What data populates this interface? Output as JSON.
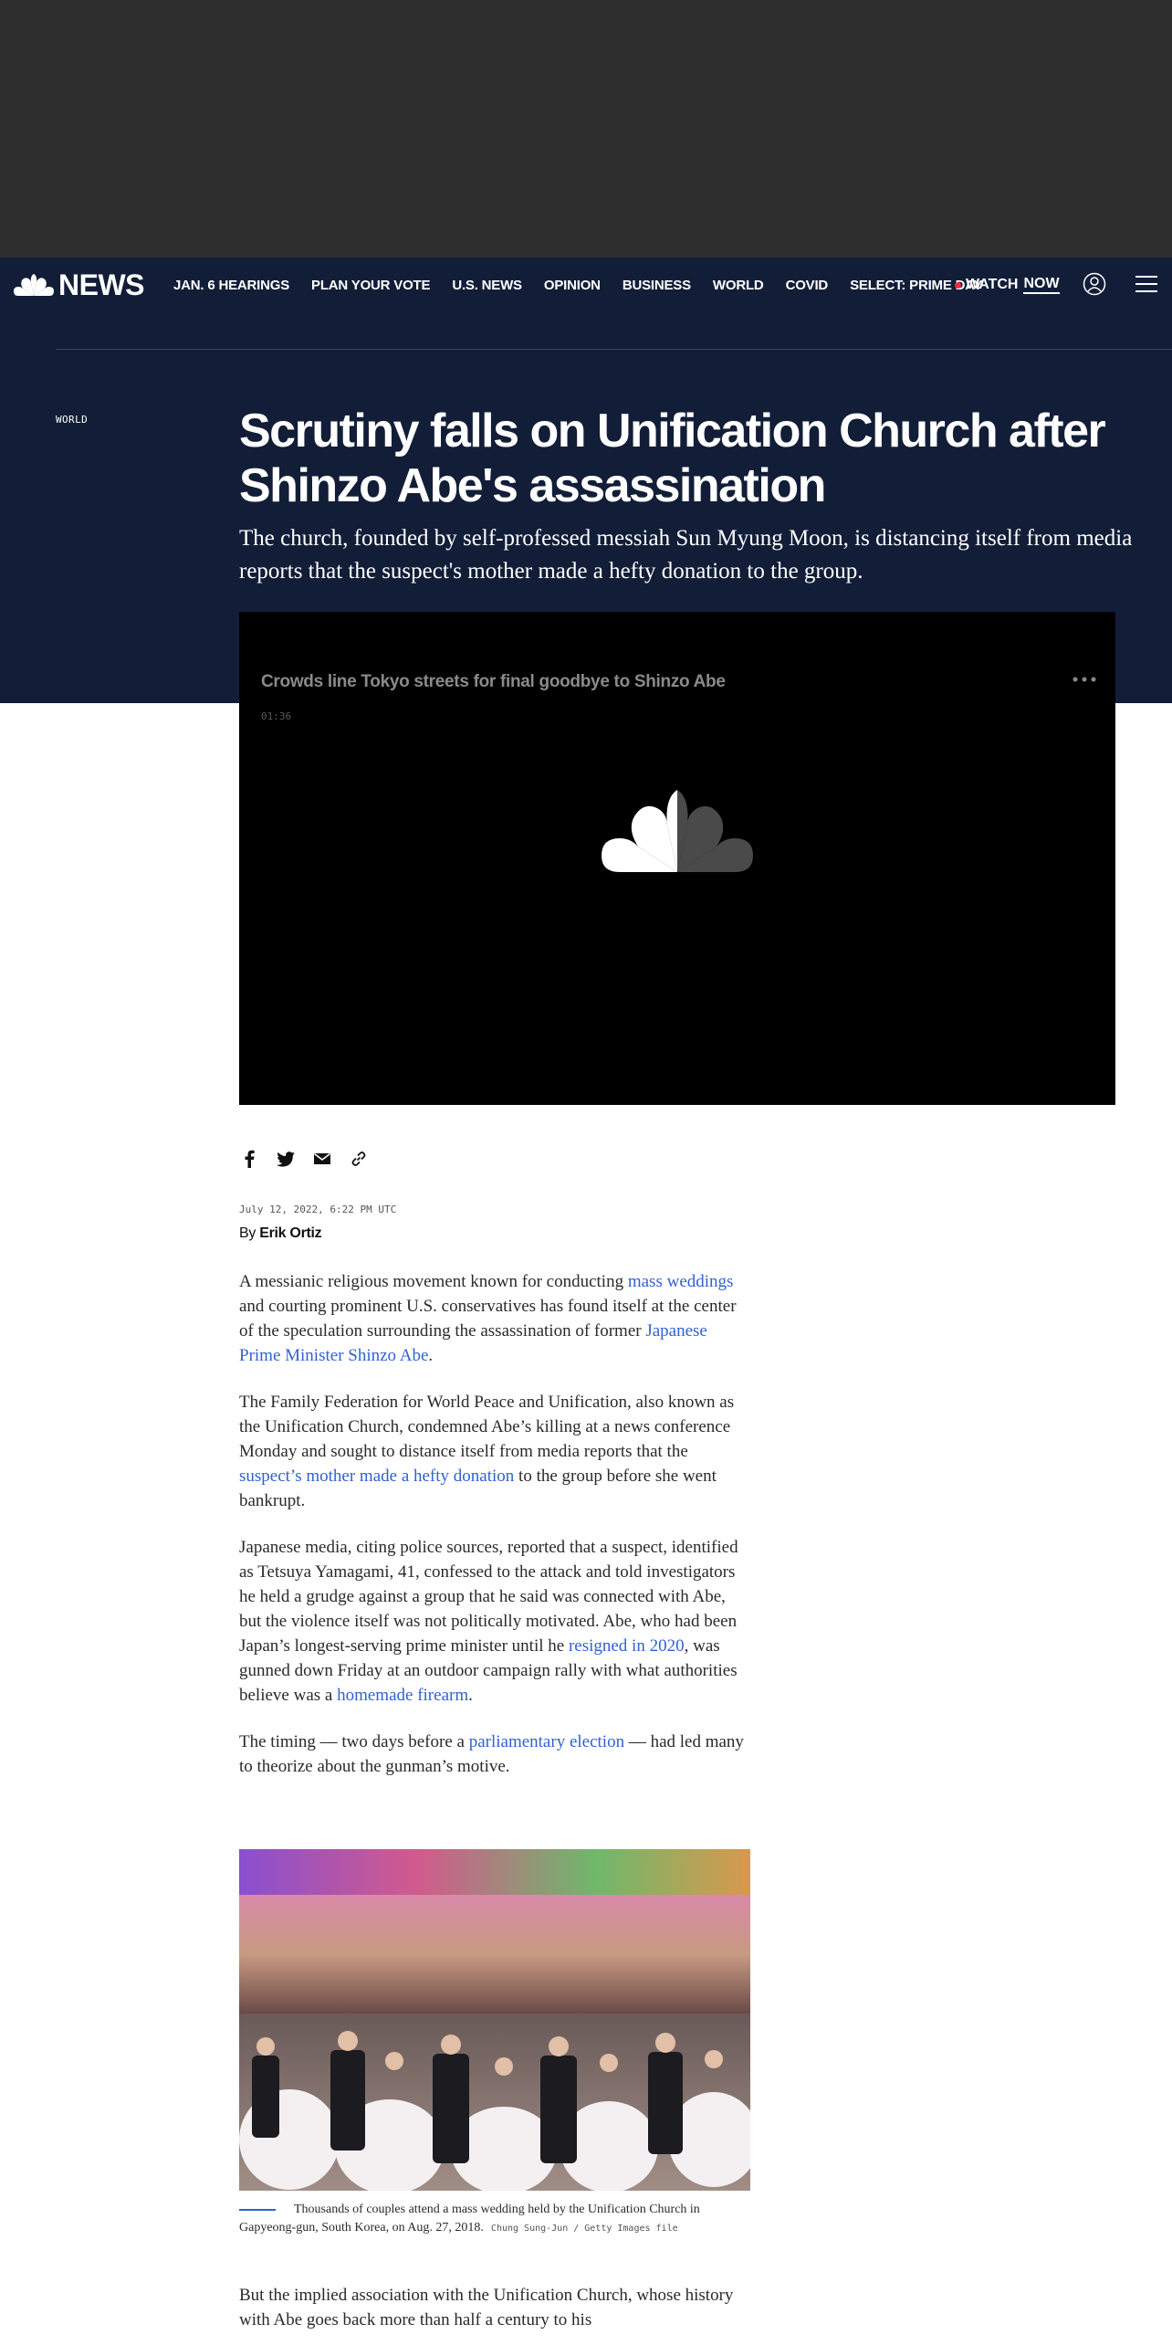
{
  "nav": {
    "logo_text": "NEWS",
    "links": [
      "JAN. 6 HEARINGS",
      "PLAN YOUR VOTE",
      "U.S. NEWS",
      "OPINION",
      "BUSINESS",
      "WORLD",
      "COVID",
      "SELECT: PRIME DAY"
    ],
    "watch_label": "WATCH",
    "watch_now": "NOW"
  },
  "article": {
    "section": "WORLD",
    "headline": "Scrutiny falls on Unification Church after Shinzo Abe's assassination",
    "dek": "The church, founded by self-professed messiah Sun Myung Moon, is distancing itself from media reports that the suspect's mother made a hefty donation to the group.",
    "date": "July 12, 2022, 6:22 PM UTC",
    "byline_prefix": "By",
    "author": "Erik Ortiz"
  },
  "video": {
    "title": "Crowds line Tokyo streets for final goodbye to Shinzo Abe",
    "duration": "01:36"
  },
  "paragraphs": {
    "p1": {
      "t1": "A messianic religious movement known for conducting ",
      "l1": "mass weddings",
      "t2": " and courting prominent U.S. conservatives has found itself at the center of the speculation surrounding the assassination of former ",
      "l2": "Japanese Prime Minister Shinzo Abe",
      "t3": "."
    },
    "p2": {
      "t1": "The Family Federation for World Peace and Unification, also known as the Unification Church, condemned Abe’s killing at a news conference Monday and sought to distance itself from media reports that the ",
      "l1": "suspect’s mother made a hefty donation",
      "t2": " to the group before she went bankrupt."
    },
    "p3": {
      "t1": "Japanese media, citing police sources, reported that a suspect, identified as Tetsuya Yamagami, 41, confessed to the attack and told investigators he held a grudge against a group that he said was connected with Abe, but the violence itself was not politically motivated. Abe, who had been Japan’s longest-serving prime minister until he ",
      "l1": "resigned in 2020",
      "t2": ", was gunned down Friday at an outdoor campaign rally with what authorities believe was a ",
      "l2": "homemade firearm",
      "t3": "."
    },
    "p4": {
      "t1": "The timing — two days before a ",
      "l1": "parliamentary election",
      "t2": " — had led many to theorize about the gunman’s motive."
    },
    "p5": "But the implied association with the Unification Church, whose history with Abe goes back more than half a century to his"
  },
  "photo": {
    "caption": "Thousands of couples attend a mass wedding held by the Unification Church in Gapyeong-gun, South Korea, on Aug. 27, 2018.",
    "credit": "Chung Sung-Jun / Getty Images file"
  },
  "colors": {
    "hero_bg": "#121e38",
    "ad_bg": "#2d2d2d",
    "link": "#3061d4",
    "live": "#ff2a3a"
  }
}
